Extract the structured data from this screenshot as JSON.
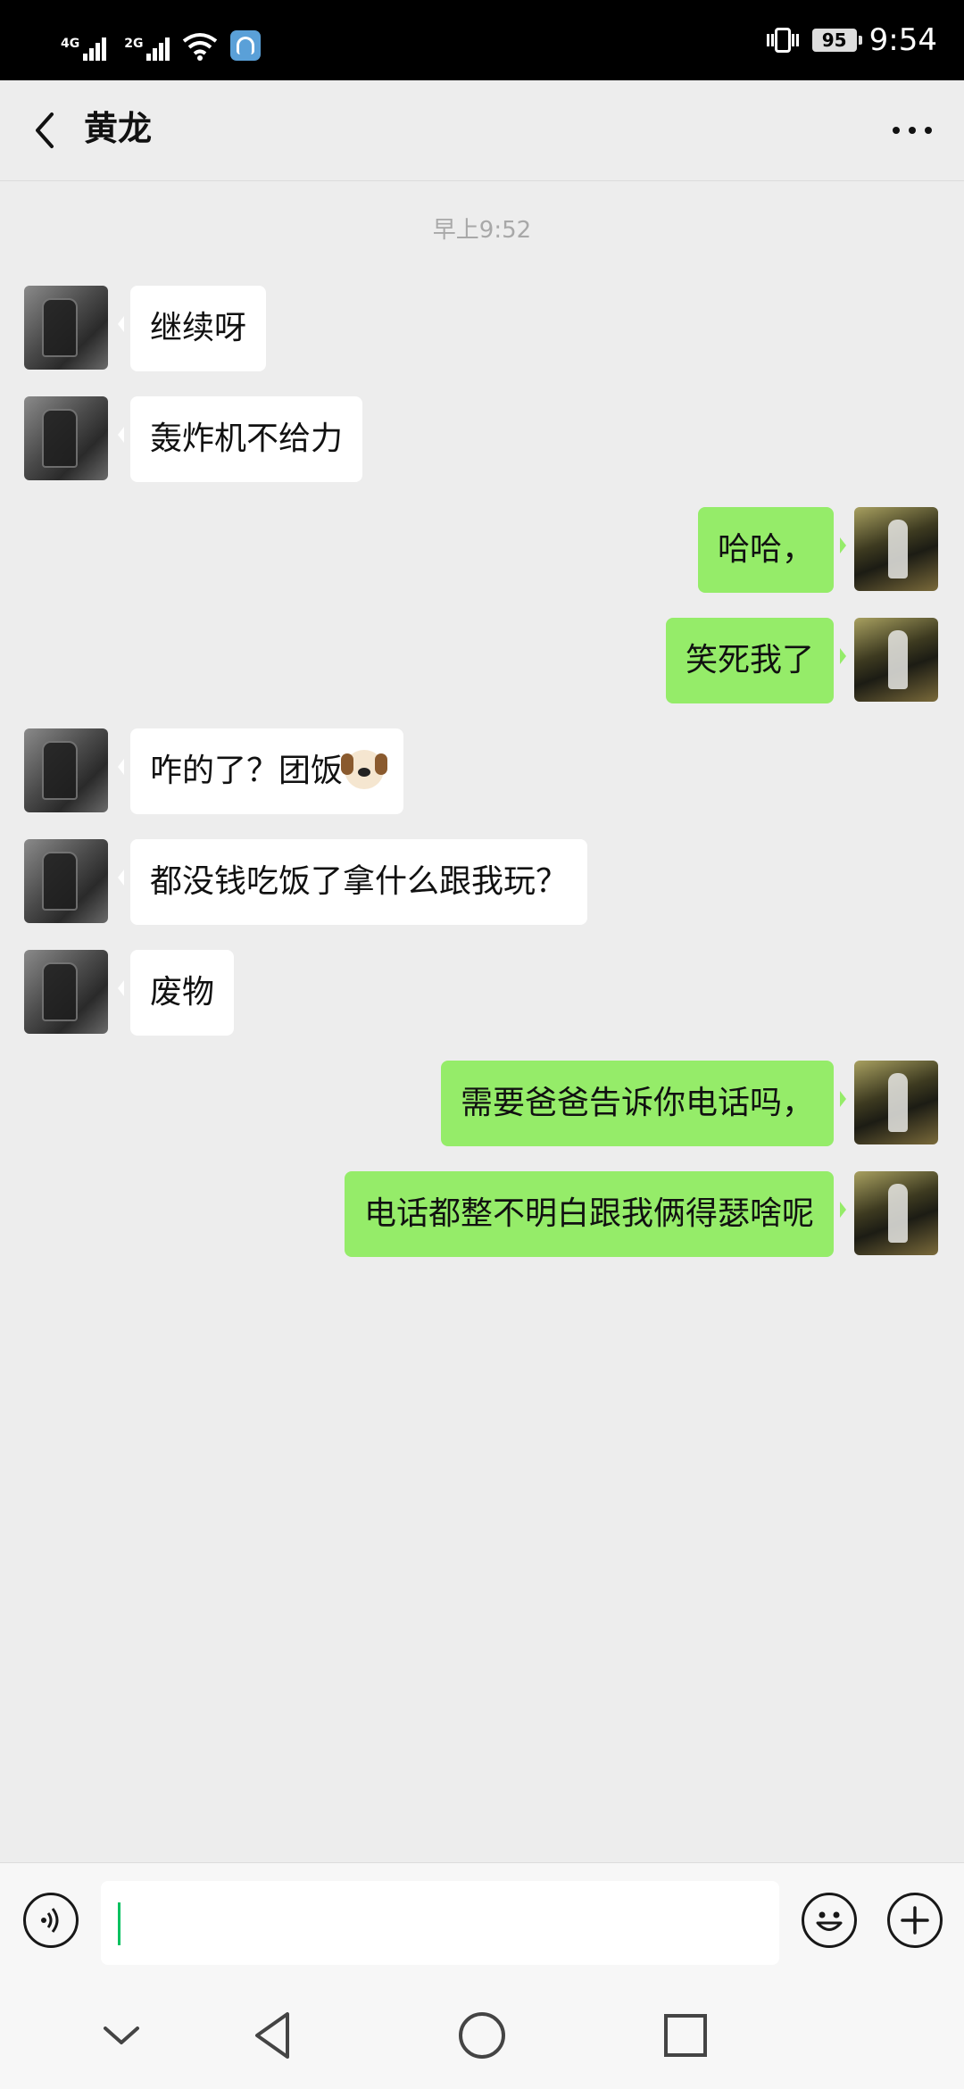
{
  "status_bar": {
    "network1": "4G",
    "network2": "2G",
    "battery": "95",
    "time": "9:54"
  },
  "header": {
    "title": "黄龙",
    "back_icon": "chevron-left-icon",
    "more_icon": "more-horizontal-icon"
  },
  "chat": {
    "timestamp": "早上9:52",
    "messages": [
      {
        "side": "left",
        "text": "继续呀"
      },
      {
        "side": "left",
        "text": "轰炸机不给力"
      },
      {
        "side": "right",
        "text": "哈哈，"
      },
      {
        "side": "right",
        "text": "笑死我了"
      },
      {
        "side": "left",
        "text": "咋的了？团饭",
        "emoji": "dog-face-emoji"
      },
      {
        "side": "left",
        "text": "都没钱吃饭了拿什么跟我玩？"
      },
      {
        "side": "left",
        "text": "废物"
      },
      {
        "side": "right",
        "text": "需要爸爸告诉你电话吗，"
      },
      {
        "side": "right",
        "text": "电话都整不明白跟我俩得瑟啥呢"
      }
    ]
  },
  "input_bar": {
    "value": "",
    "voice_icon": "voice-icon",
    "emoji_icon": "emoji-icon",
    "plus_icon": "plus-icon"
  },
  "system_nav": {
    "icons": [
      "chevron-down-icon",
      "back-triangle-icon",
      "home-circle-icon",
      "recents-square-icon"
    ]
  },
  "colors": {
    "background": "#ededed",
    "bubble_self": "#95ec69",
    "bubble_other": "#ffffff",
    "caret": "#07c160"
  }
}
